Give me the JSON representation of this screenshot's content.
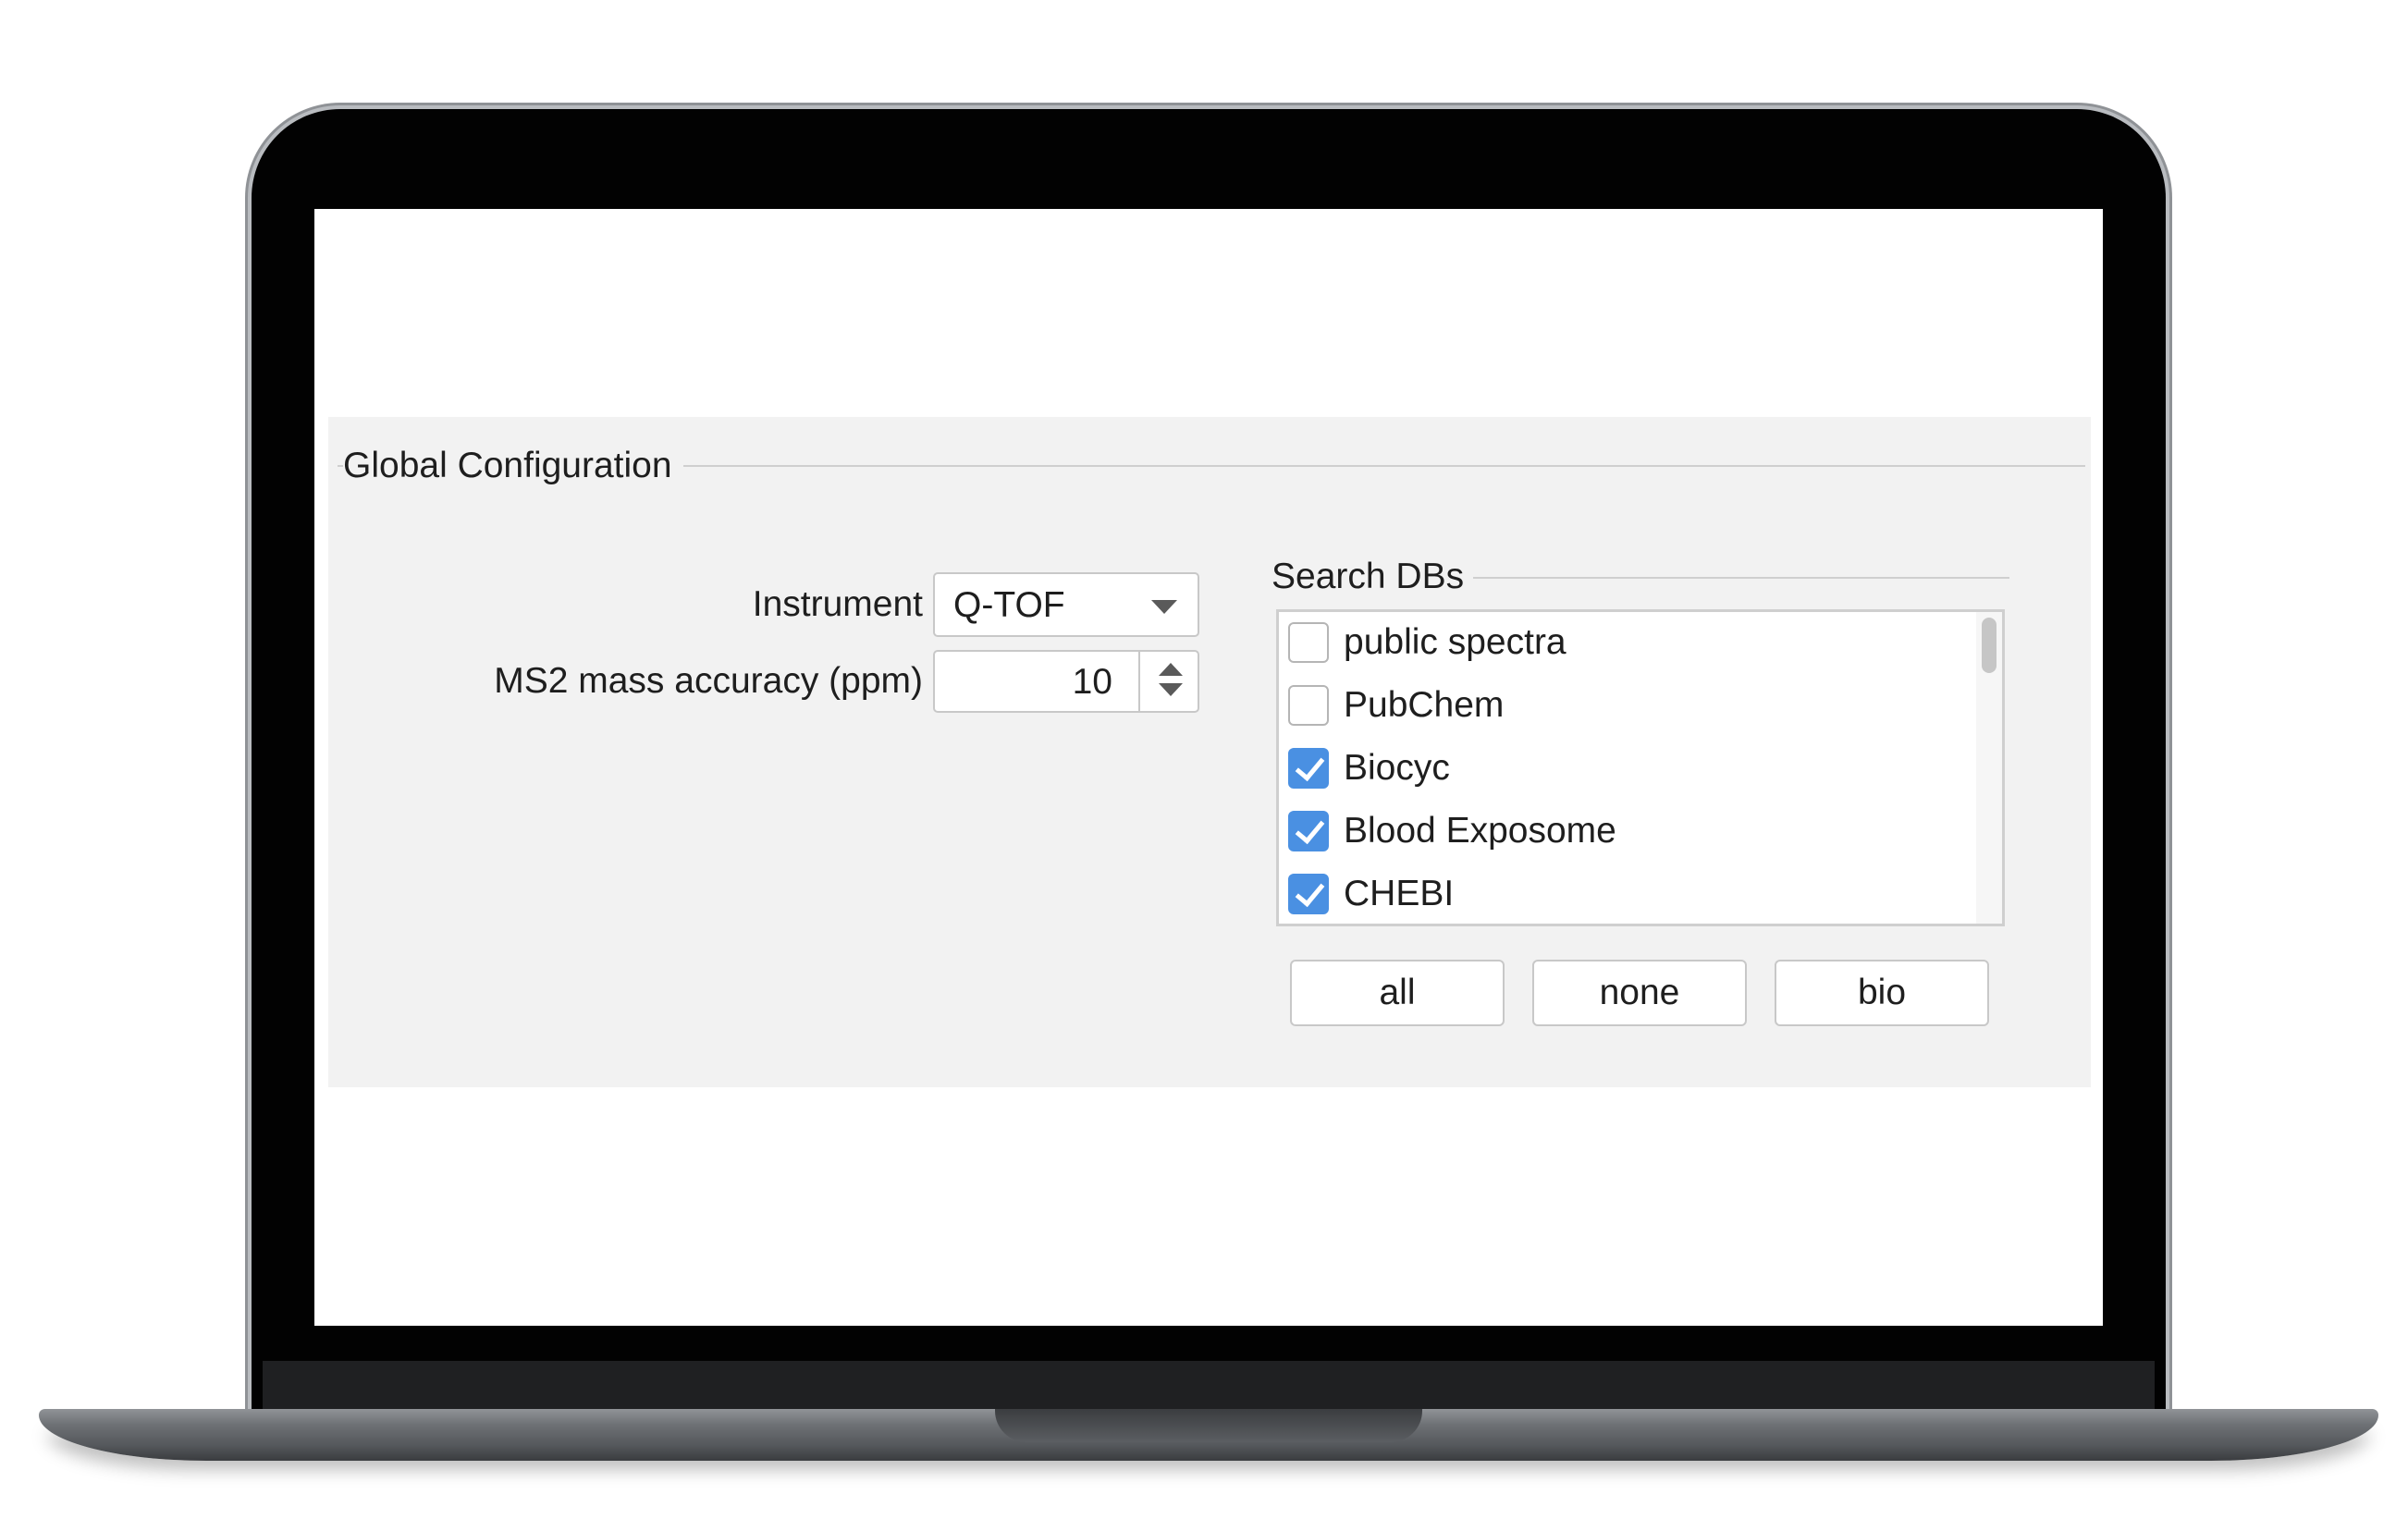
{
  "global_config": {
    "title": "Global Configuration"
  },
  "instrument": {
    "label": "Instrument",
    "value": "Q-TOF"
  },
  "ms2_accuracy": {
    "label": "MS2 mass accuracy (ppm)",
    "value": "10"
  },
  "search_dbs": {
    "title": "Search DBs",
    "items": [
      {
        "label": "public spectra",
        "checked": false
      },
      {
        "label": "PubChem",
        "checked": false
      },
      {
        "label": "Biocyc",
        "checked": true
      },
      {
        "label": "Blood Exposome",
        "checked": true
      },
      {
        "label": "CHEBI",
        "checked": true
      }
    ],
    "buttons": {
      "all": "all",
      "none": "none",
      "bio": "bio"
    }
  },
  "colors": {
    "checkbox_checked": "#4a90e2",
    "panel_background": "#f2f2f2"
  }
}
